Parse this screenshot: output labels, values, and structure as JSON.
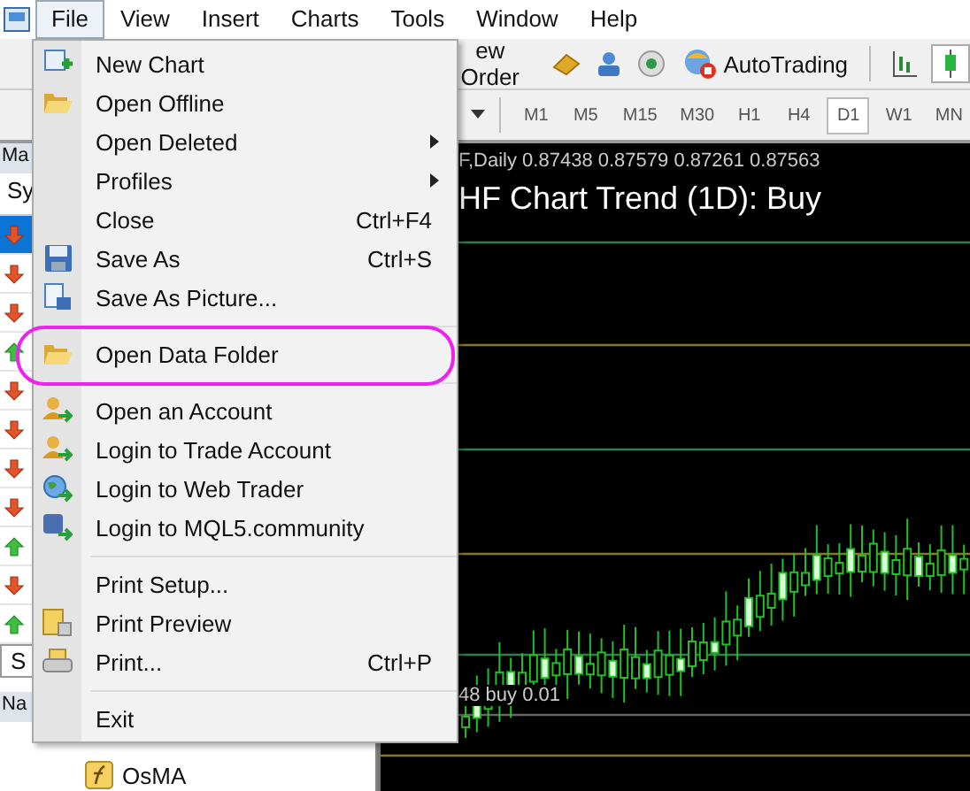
{
  "menu_bar": [
    {
      "label": "File",
      "selected": true
    },
    {
      "label": "View",
      "selected": false
    },
    {
      "label": "Insert",
      "selected": false
    },
    {
      "label": "Charts",
      "selected": false
    },
    {
      "label": "Tools",
      "selected": false
    },
    {
      "label": "Window",
      "selected": false
    },
    {
      "label": "Help",
      "selected": false
    }
  ],
  "toolbar": {
    "new_order_label": "ew Order",
    "autotrading_label": "AutoTrading"
  },
  "timeframes": [
    {
      "label": "M1",
      "selected": false
    },
    {
      "label": "M5",
      "selected": false
    },
    {
      "label": "M15",
      "selected": false
    },
    {
      "label": "M30",
      "selected": false
    },
    {
      "label": "H1",
      "selected": false
    },
    {
      "label": "H4",
      "selected": false
    },
    {
      "label": "D1",
      "selected": true
    },
    {
      "label": "W1",
      "selected": false
    },
    {
      "label": "MN",
      "selected": false
    }
  ],
  "market_watch": {
    "title": "Ma",
    "column": "Sy",
    "tab": "S",
    "rows": [
      {
        "kind": "down",
        "selected": true
      },
      {
        "kind": "down",
        "selected": false
      },
      {
        "kind": "down",
        "selected": false
      },
      {
        "kind": "up",
        "selected": false
      },
      {
        "kind": "down",
        "selected": false
      },
      {
        "kind": "down",
        "selected": false
      },
      {
        "kind": "down",
        "selected": false
      },
      {
        "kind": "down",
        "selected": false
      },
      {
        "kind": "up",
        "selected": false
      },
      {
        "kind": "down",
        "selected": false
      },
      {
        "kind": "up",
        "selected": false
      }
    ]
  },
  "navigator": {
    "title": "Na",
    "items": [
      "OsMA"
    ]
  },
  "chart": {
    "info": "F,Daily  0.87438 0.87579 0.87261 0.87563",
    "title": "HF Chart Trend (1D): Buy",
    "order_label": "48 buy 0.01"
  },
  "file_menu": [
    {
      "kind": "item",
      "label": "New Chart"
    },
    {
      "kind": "item",
      "label": "Open Offline"
    },
    {
      "kind": "item",
      "label": "Open Deleted",
      "submenu": true
    },
    {
      "kind": "item",
      "label": "Profiles",
      "submenu": true
    },
    {
      "kind": "item",
      "label": "Close",
      "shortcut": "Ctrl+F4"
    },
    {
      "kind": "item",
      "label": "Save As",
      "shortcut": "Ctrl+S"
    },
    {
      "kind": "item",
      "label": "Save As Picture..."
    },
    {
      "kind": "separator"
    },
    {
      "kind": "item",
      "label": "Open Data Folder",
      "highlighted": true
    },
    {
      "kind": "separator"
    },
    {
      "kind": "item",
      "label": "Open an Account"
    },
    {
      "kind": "item",
      "label": "Login to Trade Account"
    },
    {
      "kind": "item",
      "label": "Login to Web Trader"
    },
    {
      "kind": "item",
      "label": "Login to MQL5.community"
    },
    {
      "kind": "separator"
    },
    {
      "kind": "item",
      "label": "Print Setup..."
    },
    {
      "kind": "item",
      "label": "Print Preview"
    },
    {
      "kind": "item",
      "label": "Print...",
      "shortcut": "Ctrl+P"
    },
    {
      "kind": "separator"
    },
    {
      "kind": "item",
      "label": "Exit"
    }
  ]
}
